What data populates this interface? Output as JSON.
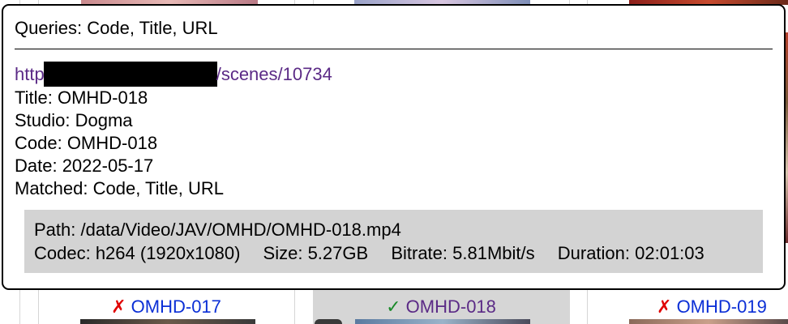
{
  "popover": {
    "header": "Queries: Code, Title, URL",
    "url_start": "http",
    "url_end": "/scenes/10734",
    "title_line": "Title: OMHD-018",
    "studio_line": "Studio: Dogma",
    "code_line": "Code: OMHD-018",
    "date_line": "Date: 2022-05-17",
    "matched_line": "Matched: Code, Title, URL",
    "file": {
      "path": "Path: /data/Video/JAV/OMHD/OMHD-018.mp4",
      "codec": "Codec: h264 (1920x1080)",
      "size": "Size: 5.27GB",
      "bitrate": "Bitrate: 5.81Mbit/s",
      "duration": "Duration: 02:01:03"
    }
  },
  "cards": [
    {
      "mark": "✗",
      "status": "no-match",
      "label": "OMHD-017"
    },
    {
      "mark": "✓",
      "status": "match",
      "label": "OMHD-018"
    },
    {
      "mark": "✗",
      "status": "no-match",
      "label": "OMHD-019"
    }
  ],
  "colors": {
    "link": "#0b2fd6",
    "visited_link": "#5b2a86",
    "no_match": "#e00000",
    "match": "#1a8a2a",
    "selected_card": "#d6d6d6",
    "file_box": "#d3d3d3"
  }
}
